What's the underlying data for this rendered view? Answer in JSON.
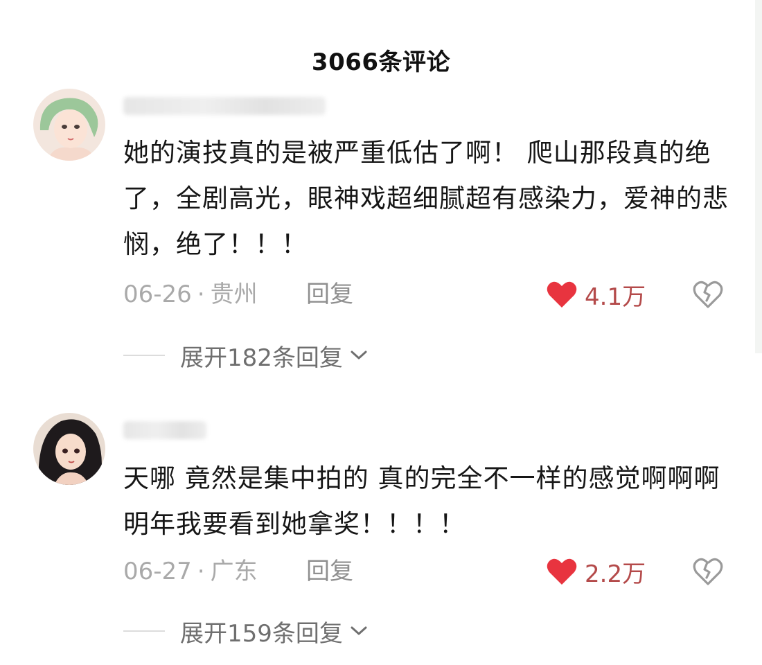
{
  "header": {
    "title": "3066条评论"
  },
  "comments": [
    {
      "text": "她的演技真的是被严重低估了啊！ 爬山那段真的绝了，全剧高光，眼神戏超细腻超有感染力，爱神的悲悯，绝了！！！",
      "date": "06-26",
      "separator": "·",
      "location": "贵州",
      "reply_label": "回复",
      "likes": "4.1万",
      "expand_label": "展开182条回复"
    },
    {
      "text": "天哪 竟然是集中拍的 真的完全不一样的感觉啊啊啊 明年我要看到她拿奖！！！！",
      "date": "06-27",
      "separator": "·",
      "location": "广东",
      "reply_label": "回复",
      "likes": "2.2万",
      "expand_label": "展开159条回复"
    }
  ],
  "colors": {
    "heart": "#e8343f",
    "like_text": "#b44a4a",
    "meta_text": "#a9a9a9"
  },
  "icons": {
    "like": "heart-icon",
    "dislike": "broken-heart-icon",
    "expand": "chevron-down-icon"
  }
}
